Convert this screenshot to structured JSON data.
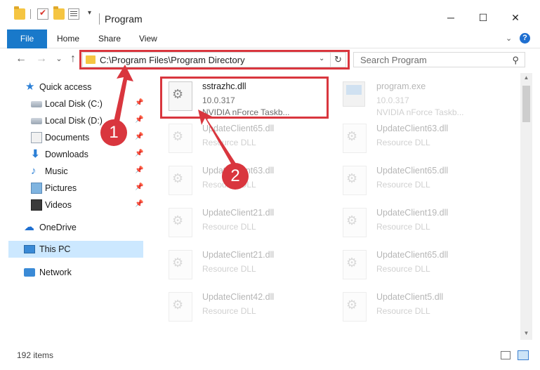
{
  "window": {
    "title": "Program",
    "controls": {
      "minimize": "─",
      "maximize": "☐",
      "close": "✕"
    }
  },
  "quick_access_toolbar": {
    "dropdown": "▾"
  },
  "ribbon": {
    "tabs": [
      "File",
      "Home",
      "Share",
      "View"
    ],
    "expand": "⌄",
    "help": "?"
  },
  "nav": {
    "back": "←",
    "forward": "→",
    "recent": "⌄",
    "up": "↑",
    "address": "C:\\Program Files\\Program Directory",
    "address_dropdown": "⌄",
    "refresh": "↻",
    "search_placeholder": "Search Program",
    "search_glyph": "⚲"
  },
  "sidebar": {
    "items": [
      {
        "label": "Quick access",
        "icon": "star-icon",
        "pinned": false
      },
      {
        "label": "Local Disk (C:)",
        "icon": "disk-icon",
        "pinned": true
      },
      {
        "label": "Local Disk (D:)",
        "icon": "disk-icon",
        "pinned": true
      },
      {
        "label": "Documents",
        "icon": "documents-icon",
        "pinned": true
      },
      {
        "label": "Downloads",
        "icon": "downloads-icon",
        "pinned": true
      },
      {
        "label": "Music",
        "icon": "music-icon",
        "pinned": true
      },
      {
        "label": "Pictures",
        "icon": "pictures-icon",
        "pinned": true
      },
      {
        "label": "Videos",
        "icon": "videos-icon",
        "pinned": true
      },
      {
        "label": "OneDrive",
        "icon": "onedrive-icon",
        "pinned": false
      },
      {
        "label": "This PC",
        "icon": "this-pc-icon",
        "pinned": false,
        "selected": true
      },
      {
        "label": "Network",
        "icon": "network-icon",
        "pinned": false
      }
    ],
    "pin_glyph": "📌"
  },
  "files": [
    {
      "name": "sstrazhc.dll",
      "line2": "10.0.317",
      "line3": "NVIDIA nForce Taskb...",
      "highlighted": true
    },
    {
      "name": "program.exe",
      "line2": "10.0.317",
      "line3": "NVIDIA nForce Taskb...",
      "faded": true
    },
    {
      "name": "UpdateClient65.dll",
      "line2": "Resource DLL",
      "faded": true
    },
    {
      "name": "UpdateClient63.dll",
      "line2": "Resource DLL",
      "faded": true
    },
    {
      "name": "UpdateClient63.dll",
      "line2": "Resource DLL",
      "faded": true
    },
    {
      "name": "UpdateClient65.dll",
      "line2": "Resource DLL",
      "faded": true
    },
    {
      "name": "UpdateClient21.dll",
      "line2": "Resource DLL",
      "faded": true
    },
    {
      "name": "UpdateClient19.dll",
      "line2": "Resource DLL",
      "faded": true
    },
    {
      "name": "UpdateClient21.dll",
      "line2": "Resource DLL",
      "faded": true
    },
    {
      "name": "UpdateClient65.dll",
      "line2": "Resource DLL",
      "faded": true
    },
    {
      "name": "UpdateClient42.dll",
      "line2": "Resource DLL",
      "faded": true
    },
    {
      "name": "UpdateClient5.dll",
      "line2": "Resource DLL",
      "faded": true
    }
  ],
  "status": {
    "item_count": "192 items"
  },
  "annotations": {
    "step1": "1",
    "step2": "2",
    "color": "#d9363e"
  },
  "colors": {
    "accent": "#1979ca",
    "selected_bg": "#cce8ff",
    "highlight": "#d9363e"
  }
}
